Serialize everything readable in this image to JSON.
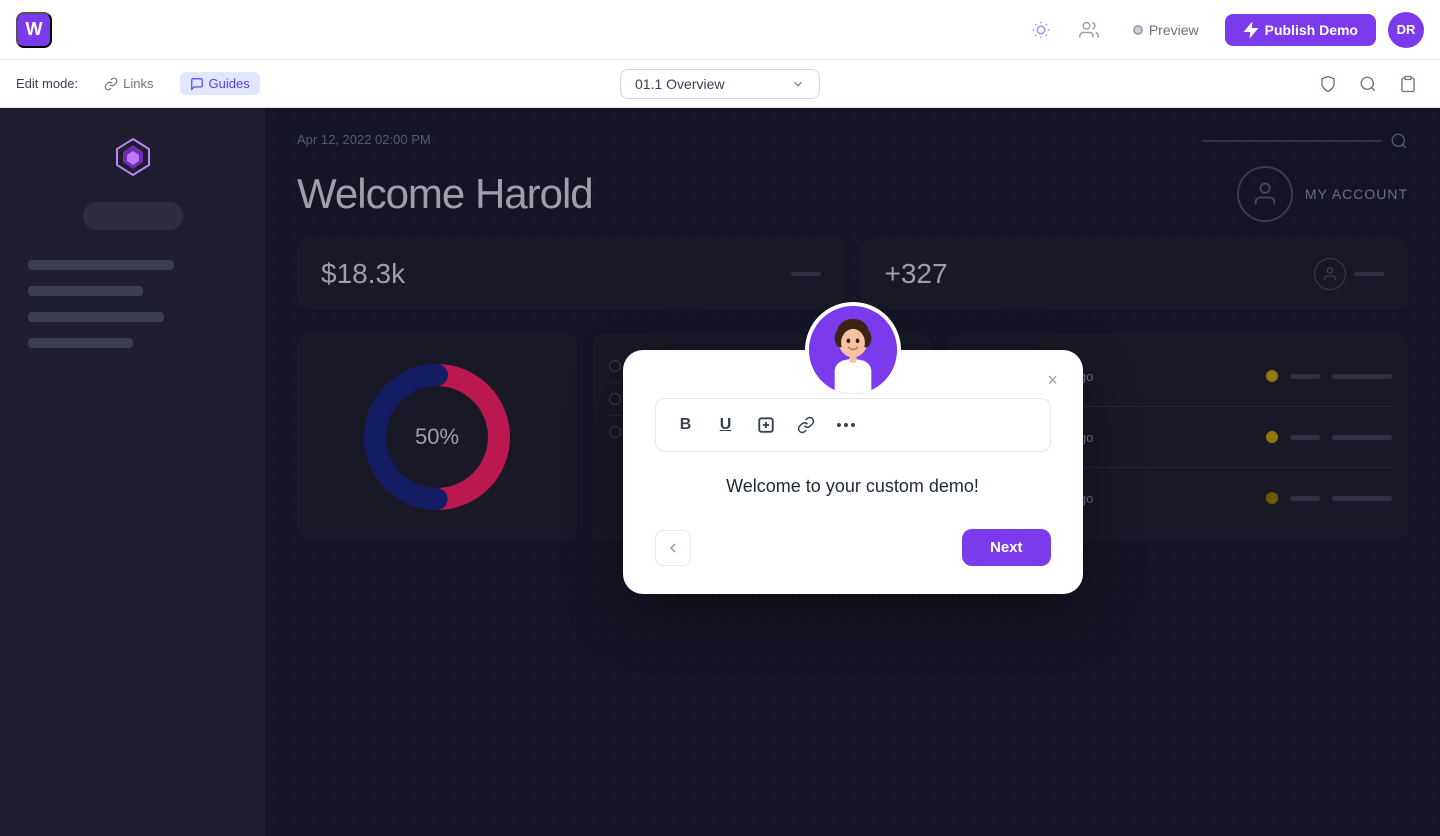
{
  "topnav": {
    "app_logo": "W",
    "avatar_label": "DR",
    "preview_label": "Preview",
    "publish_label": "Publish Demo"
  },
  "edittoolbar": {
    "edit_mode_label": "Edit mode:",
    "links_label": "Links",
    "guides_label": "Guides",
    "nav_dropdown": "01.1  Overview"
  },
  "sidebar": {
    "logo_alt": "app logo"
  },
  "dashboard": {
    "date": "Apr 12, 2022 02:00 PM",
    "welcome": "Welcome Harold",
    "my_account": "MY ACCOUNT",
    "stat1_value": "$18.3k",
    "stat2_value": "+327",
    "donut_label": "50%",
    "generic_logo_1": "Generic Logo",
    "generic_logo_2": "Generic Logo",
    "generic_logo_3": "Generic Logo"
  },
  "modal": {
    "content": "Welcome to your custom demo!",
    "next_label": "Next",
    "close_icon": "×",
    "prev_icon": "‹",
    "toolbar_bold": "B",
    "toolbar_underline": "U",
    "toolbar_add": "+",
    "toolbar_link": "🔗",
    "toolbar_more": "•••"
  }
}
